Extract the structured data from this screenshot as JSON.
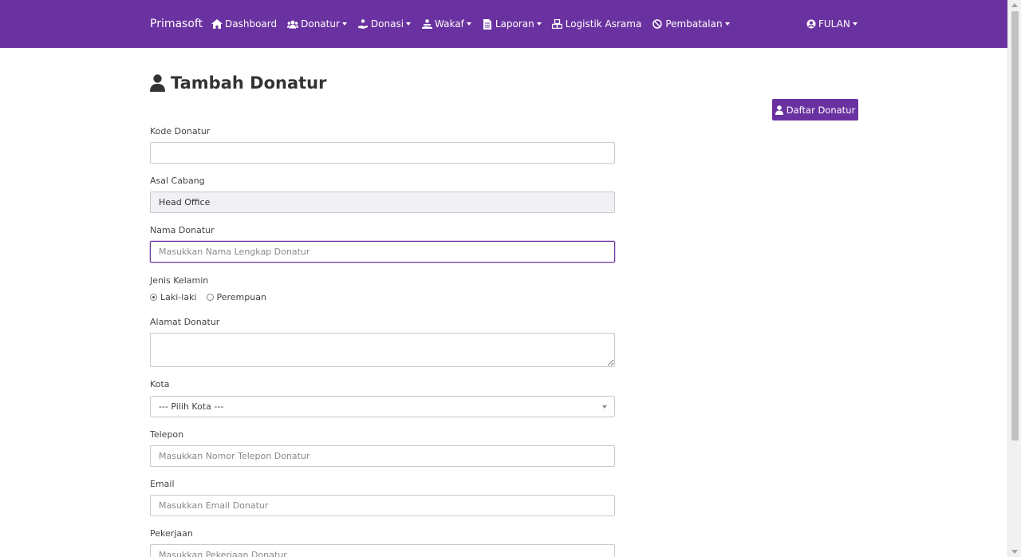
{
  "navbar": {
    "brand": "Primasoft",
    "items": [
      {
        "label": "Dashboard",
        "icon": "home-icon",
        "dropdown": false
      },
      {
        "label": "Donatur",
        "icon": "users-icon",
        "dropdown": true
      },
      {
        "label": "Donasi",
        "icon": "donate-hand-icon",
        "dropdown": true
      },
      {
        "label": "Wakaf",
        "icon": "wakaf-hand-icon",
        "dropdown": true
      },
      {
        "label": "Laporan",
        "icon": "file-icon",
        "dropdown": true
      },
      {
        "label": "Logistik Asrama",
        "icon": "cubes-icon",
        "dropdown": false
      },
      {
        "label": "Pembatalan",
        "icon": "ban-icon",
        "dropdown": true
      }
    ],
    "user": "FULAN"
  },
  "page": {
    "title": "Tambah Donatur",
    "list_button": "Daftar Donatur"
  },
  "form": {
    "kode": {
      "label": "Kode Donatur",
      "value": "",
      "placeholder": ""
    },
    "cabang": {
      "label": "Asal Cabang",
      "value": "Head Office"
    },
    "nama": {
      "label": "Nama Donatur",
      "placeholder": "Masukkan Nama Lengkap Donatur"
    },
    "gender": {
      "label": "Jenis Kelamin",
      "options": [
        "Laki-laki",
        "Perempuan"
      ],
      "selected": "Laki-laki"
    },
    "alamat": {
      "label": "Alamat Donatur"
    },
    "kota": {
      "label": "Kota",
      "selected": "--- Pilih Kota ---"
    },
    "telepon": {
      "label": "Telepon",
      "placeholder": "Masukkan Nomor Telepon Donatur"
    },
    "email": {
      "label": "Email",
      "placeholder": "Masukkan Email Donatur"
    },
    "pekerjaan": {
      "label": "Pekerjaan",
      "placeholder": "Masukkan Pekerjaan Donatur"
    }
  },
  "colors": {
    "primary": "#6a32a0"
  }
}
